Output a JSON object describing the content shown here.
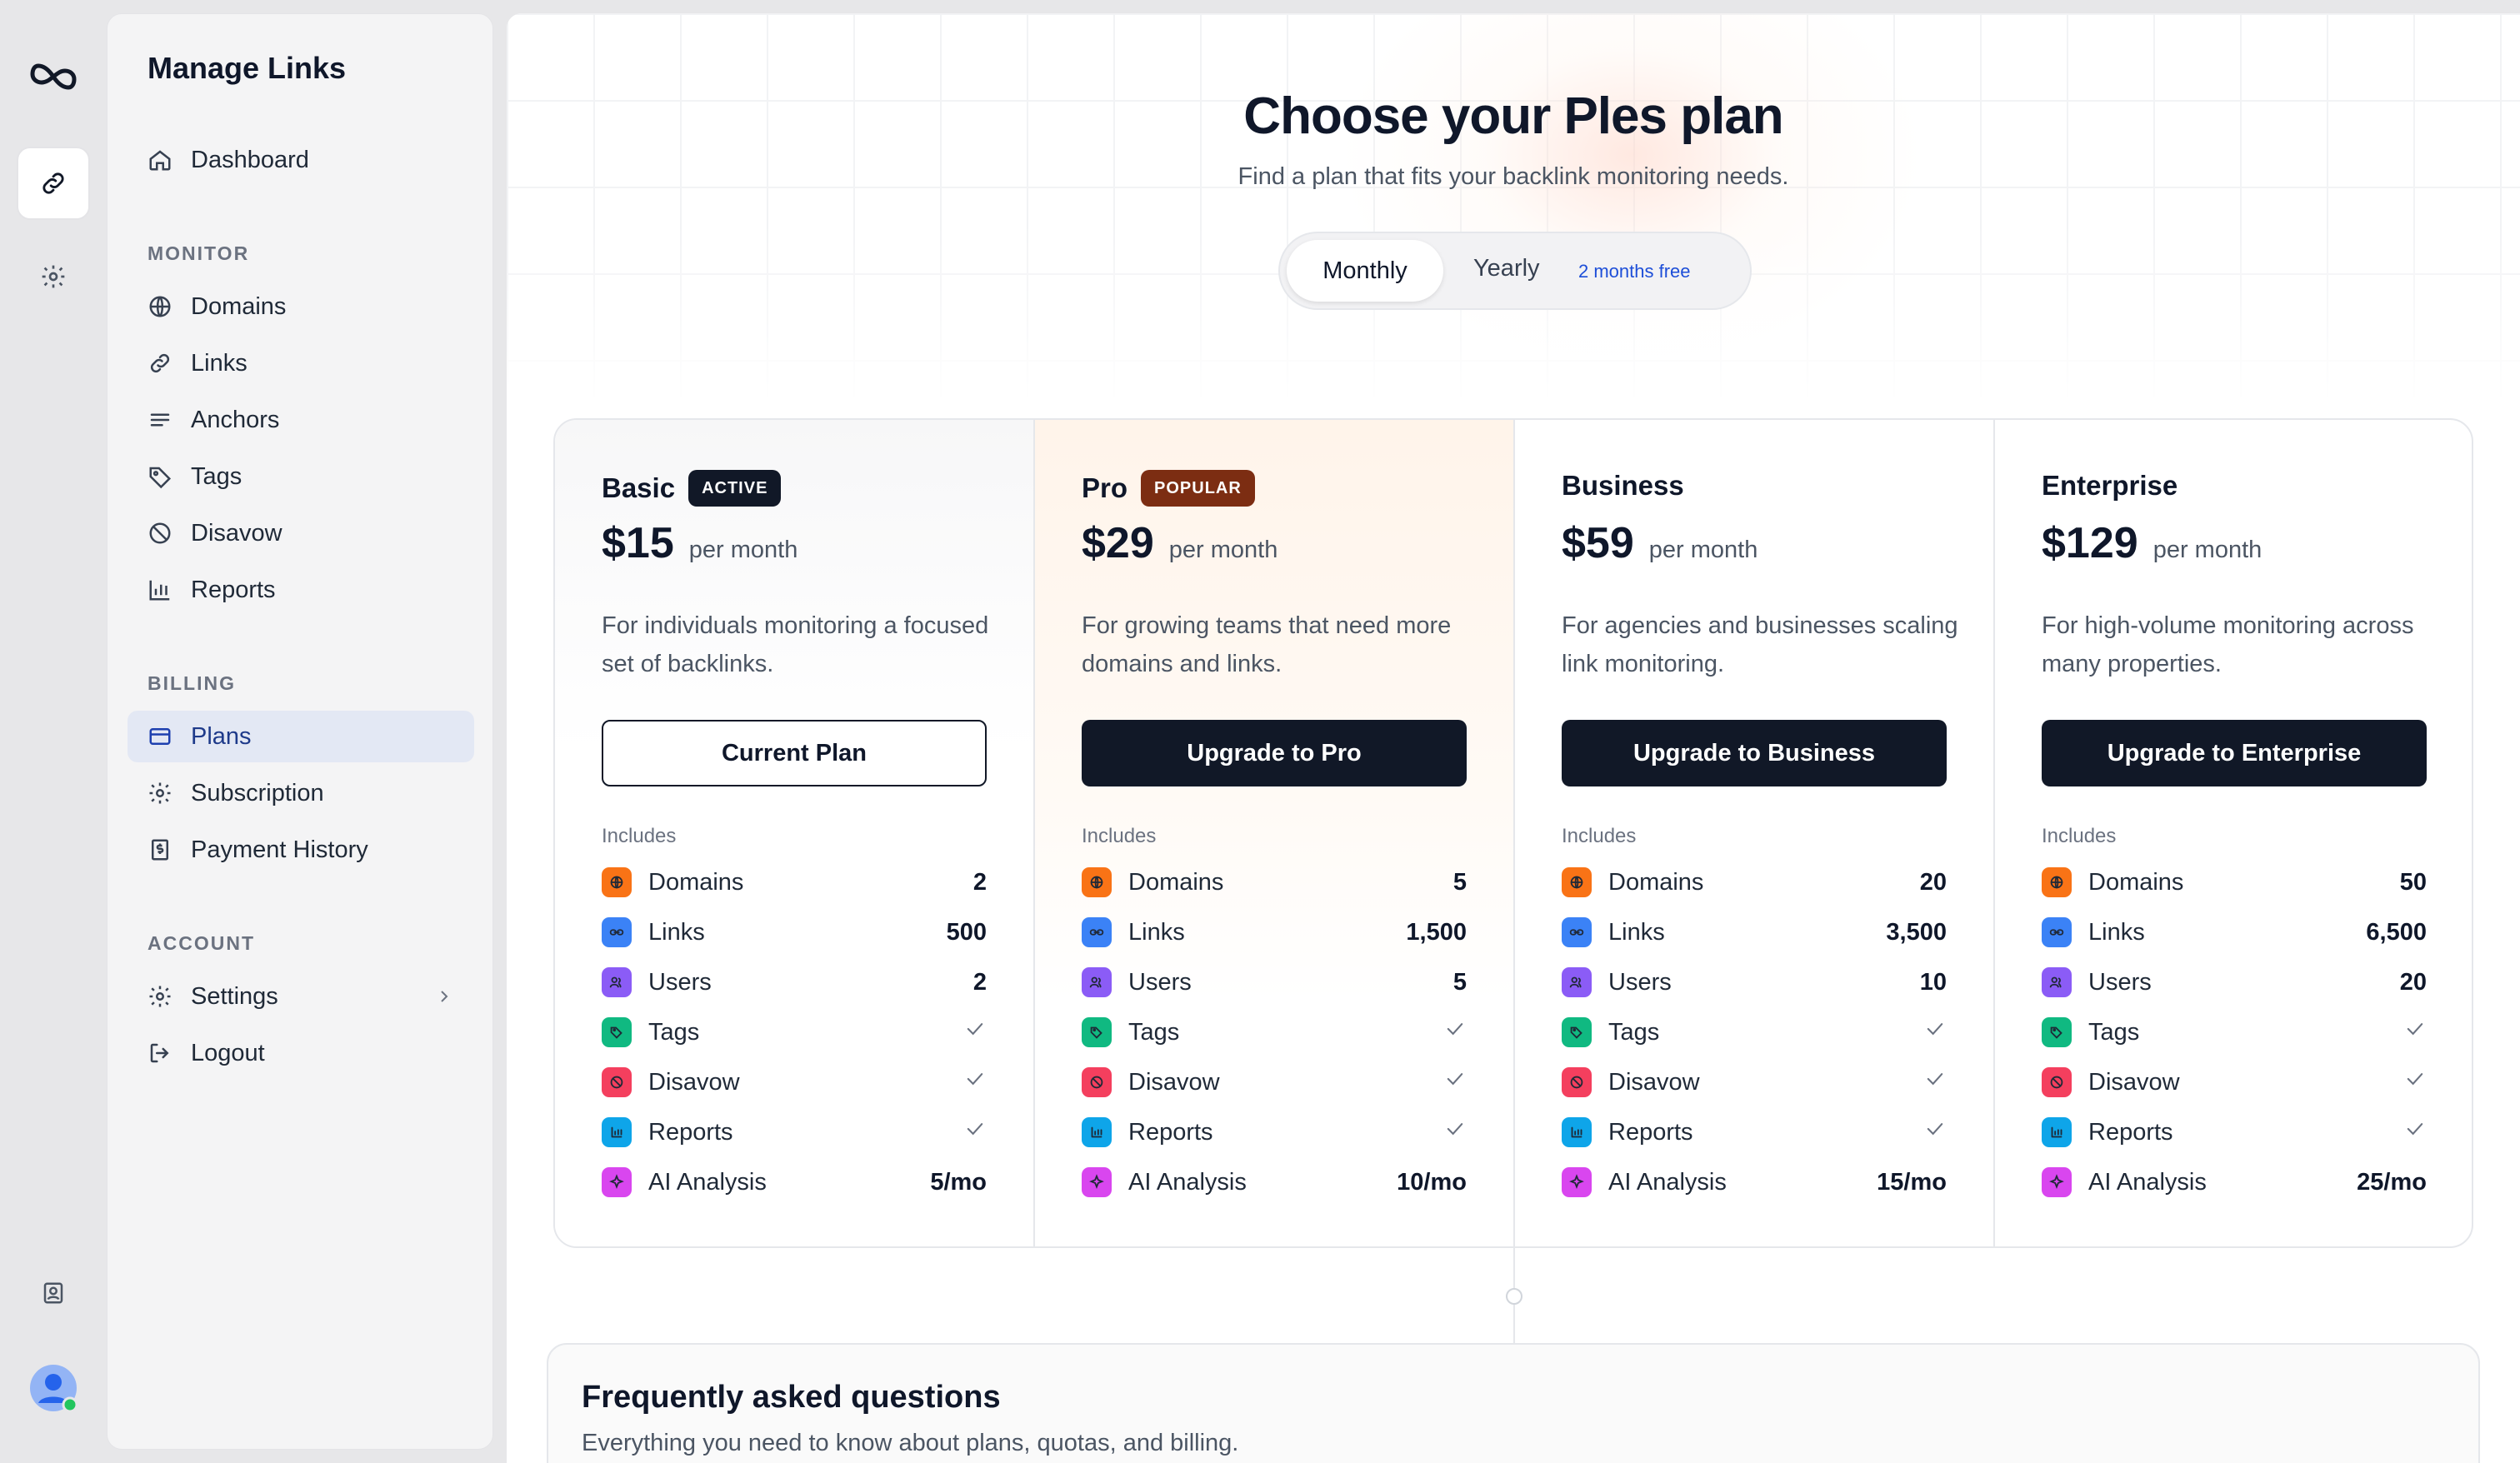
{
  "sidebar": {
    "title": "Manage Links",
    "dashboard": "Dashboard",
    "sections": {
      "monitor": "MONITOR",
      "billing": "BILLING",
      "account": "ACCOUNT"
    },
    "monitor_items": [
      "Domains",
      "Links",
      "Anchors",
      "Tags",
      "Disavow",
      "Reports"
    ],
    "billing_items": [
      "Plans",
      "Subscription",
      "Payment History"
    ],
    "account_items": [
      "Settings",
      "Logout"
    ],
    "active_item": "Plans"
  },
  "header": {
    "title": "Choose your Ples plan",
    "subtitle": "Find a plan that fits your backlink monitoring needs."
  },
  "billing_toggle": {
    "monthly": "Monthly",
    "yearly": "Yearly",
    "yearly_badge": "2 months free",
    "selected": "Monthly"
  },
  "plans": [
    {
      "name": "Basic",
      "badge": "ACTIVE",
      "price": "$15",
      "period": "per month",
      "desc": "For individuals monitoring a focused set of backlinks.",
      "cta": "Current Plan",
      "includes": "Includes",
      "features": [
        [
          "Domains",
          "2"
        ],
        [
          "Links",
          "500"
        ],
        [
          "Users",
          "2"
        ],
        [
          "Tags",
          "✓"
        ],
        [
          "Disavow",
          "✓"
        ],
        [
          "Reports",
          "✓"
        ],
        [
          "AI Analysis",
          "5/mo"
        ]
      ]
    },
    {
      "name": "Pro",
      "badge": "POPULAR",
      "price": "$29",
      "period": "per month",
      "desc": "For growing teams that need more domains and links.",
      "cta": "Upgrade to Pro",
      "includes": "Includes",
      "features": [
        [
          "Domains",
          "5"
        ],
        [
          "Links",
          "1,500"
        ],
        [
          "Users",
          "5"
        ],
        [
          "Tags",
          "✓"
        ],
        [
          "Disavow",
          "✓"
        ],
        [
          "Reports",
          "✓"
        ],
        [
          "AI Analysis",
          "10/mo"
        ]
      ]
    },
    {
      "name": "Business",
      "badge": "",
      "price": "$59",
      "period": "per month",
      "desc": "For agencies and businesses scaling link monitoring.",
      "cta": "Upgrade to Business",
      "includes": "Includes",
      "features": [
        [
          "Domains",
          "20"
        ],
        [
          "Links",
          "3,500"
        ],
        [
          "Users",
          "10"
        ],
        [
          "Tags",
          "✓"
        ],
        [
          "Disavow",
          "✓"
        ],
        [
          "Reports",
          "✓"
        ],
        [
          "AI Analysis",
          "15/mo"
        ]
      ]
    },
    {
      "name": "Enterprise",
      "badge": "",
      "price": "$129",
      "period": "per month",
      "desc": "For high-volume monitoring across many properties.",
      "cta": "Upgrade to Enterprise",
      "includes": "Includes",
      "features": [
        [
          "Domains",
          "50"
        ],
        [
          "Links",
          "6,500"
        ],
        [
          "Users",
          "20"
        ],
        [
          "Tags",
          "✓"
        ],
        [
          "Disavow",
          "✓"
        ],
        [
          "Reports",
          "✓"
        ],
        [
          "AI Analysis",
          "25/mo"
        ]
      ]
    }
  ],
  "feature_colors": {
    "Domains": "#f97316",
    "Links": "#3b82f6",
    "Users": "#8b5cf6",
    "Tags": "#10b981",
    "Disavow": "#f43f5e",
    "Reports": "#0ea5e9",
    "AI Analysis": "#d946ef"
  },
  "faq": {
    "title": "Frequently asked questions",
    "subtitle": "Everything you need to know about plans, quotas, and billing."
  }
}
